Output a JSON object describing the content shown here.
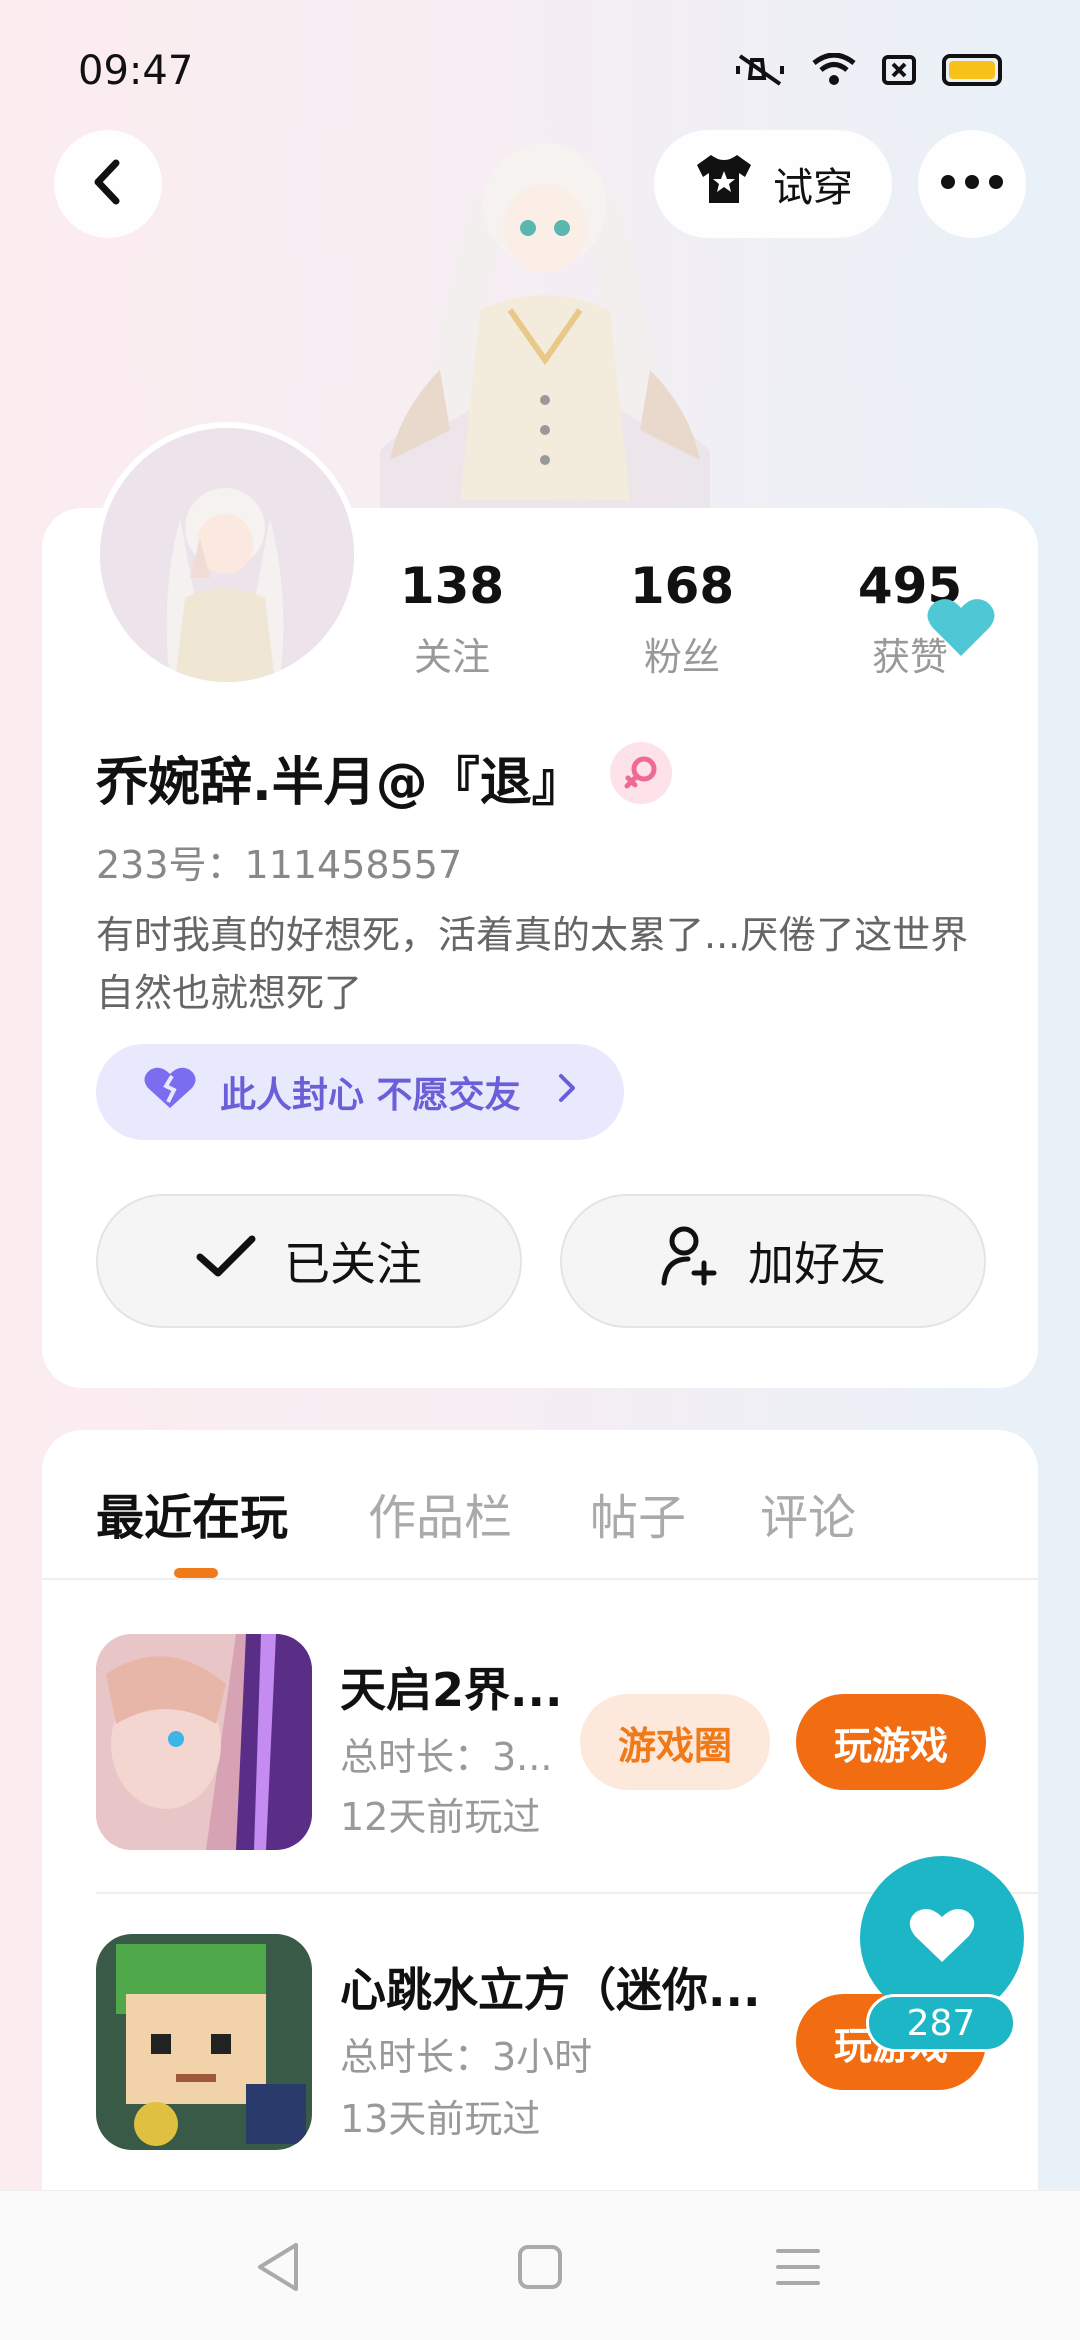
{
  "status_bar": {
    "time": "09:47",
    "icons": [
      "mute-icon",
      "wifi-icon",
      "sim-icon",
      "battery-icon"
    ],
    "battery_color": "#f6c21a"
  },
  "header": {
    "tryon_label": "试穿"
  },
  "profile": {
    "stats": [
      {
        "value": "138",
        "label": "关注"
      },
      {
        "value": "168",
        "label": "粉丝"
      },
      {
        "value": "495",
        "label": "获赞"
      }
    ],
    "username": "乔婉辞.半月@『退』",
    "gender": "female",
    "uid": "233号：111458557",
    "bio": "有时我真的好想死，活着真的太累了...厌倦了这世界自然也就想死了",
    "tag": "此人封心 不愿交友",
    "follow_label": "已关注",
    "add_friend_label": "加好友"
  },
  "tabs": [
    {
      "label": "最近在玩",
      "active": true
    },
    {
      "label": "作品栏",
      "active": false
    },
    {
      "label": "帖子",
      "active": false
    },
    {
      "label": "评论",
      "active": false
    }
  ],
  "games": [
    {
      "name": "天启2界...",
      "duration": "总时长：3...",
      "last_played": "12天前玩过",
      "circle_label": "游戏圈",
      "play_label": "玩游戏"
    },
    {
      "name": "心跳水立方（迷你...",
      "duration": "总时长：3小时",
      "last_played": "13天前玩过",
      "play_label": "玩游戏"
    }
  ],
  "like_fab": {
    "count": "287"
  },
  "colors": {
    "accent_orange": "#f26d12",
    "like_teal": "#1db6c6",
    "tag_purple": "#6b5fd8"
  }
}
